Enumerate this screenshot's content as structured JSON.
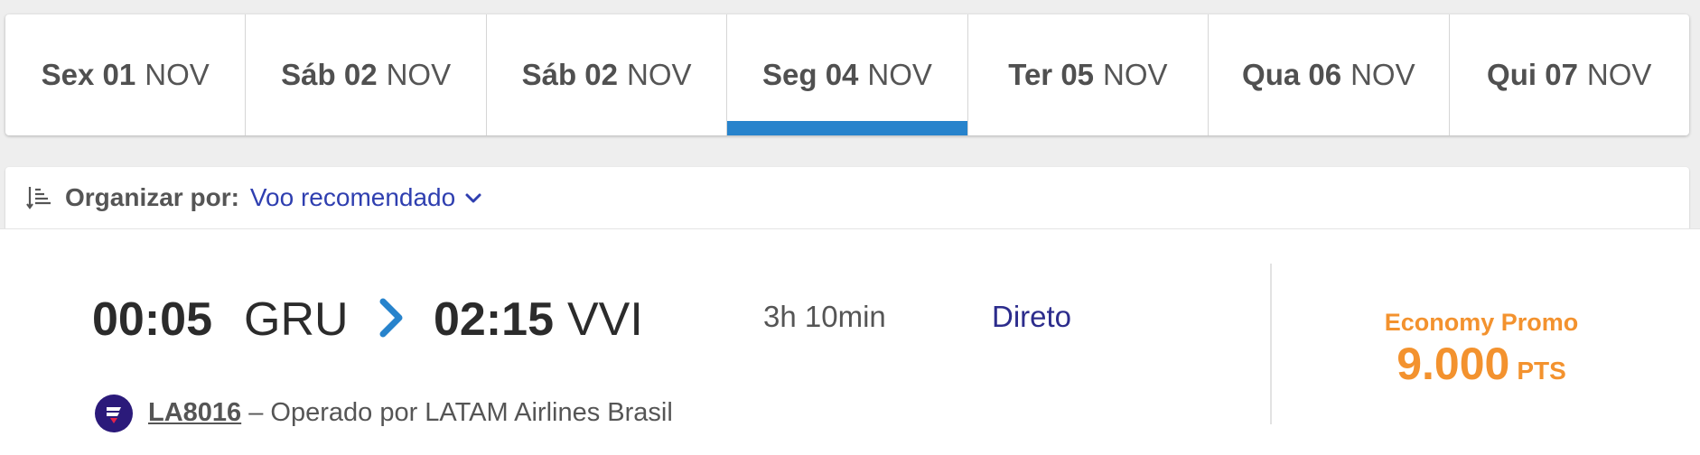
{
  "date_tabs": [
    {
      "day": "Sex 01",
      "month": "NOV",
      "active": false
    },
    {
      "day": "Sáb 02",
      "month": "NOV",
      "active": false
    },
    {
      "day": "Sáb 02",
      "month": "NOV",
      "active": false
    },
    {
      "day": "Seg 04",
      "month": "NOV",
      "active": true
    },
    {
      "day": "Ter 05",
      "month": "NOV",
      "active": false
    },
    {
      "day": "Qua 06",
      "month": "NOV",
      "active": false
    },
    {
      "day": "Qui 07",
      "month": "NOV",
      "active": false
    }
  ],
  "sort": {
    "label": "Organizar por:",
    "value": "Voo recomendado",
    "icon": "sort-icon"
  },
  "flight": {
    "departure_time": "00:05",
    "departure_code": "GRU",
    "arrival_time": "02:15",
    "arrival_code": "VVI",
    "duration": "3h 10min",
    "stops": "Direto",
    "flight_number": "LA8016",
    "operated_by": " – Operado por LATAM Airlines Brasil",
    "fare": {
      "name": "Economy Promo",
      "amount": "9.000",
      "unit": "PTS"
    }
  },
  "colors": {
    "active_tab": "#2783cc",
    "sort_value": "#2f3fb0",
    "stops": "#2c2c8c",
    "fare": "#f3922e",
    "airline_logo": "#2b1a7a"
  }
}
